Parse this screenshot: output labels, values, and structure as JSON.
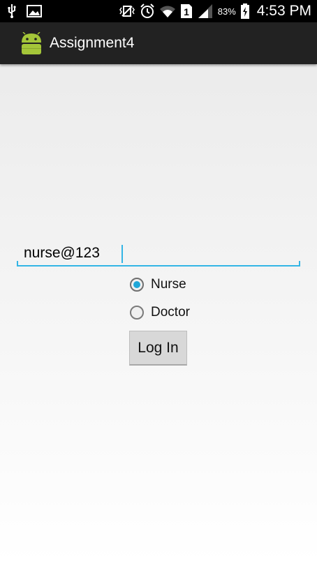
{
  "status_bar": {
    "battery_percent": "83%",
    "time": "4:53 PM",
    "sim_badge": "1",
    "icons": [
      "usb-icon",
      "image-icon",
      "vibrate-icon",
      "alarm-icon",
      "wifi-icon",
      "sim-icon",
      "signal-icon",
      "battery-charging-icon"
    ]
  },
  "action_bar": {
    "app_title": "Assignment4",
    "logo_icon": "android-logo-icon"
  },
  "form": {
    "input_value": "nurse@123",
    "radios": [
      {
        "label": "Nurse",
        "checked": true
      },
      {
        "label": "Doctor",
        "checked": false
      }
    ],
    "login_label": "Log In"
  },
  "colors": {
    "accent": "#33b5e5",
    "android_green": "#a4c639"
  }
}
